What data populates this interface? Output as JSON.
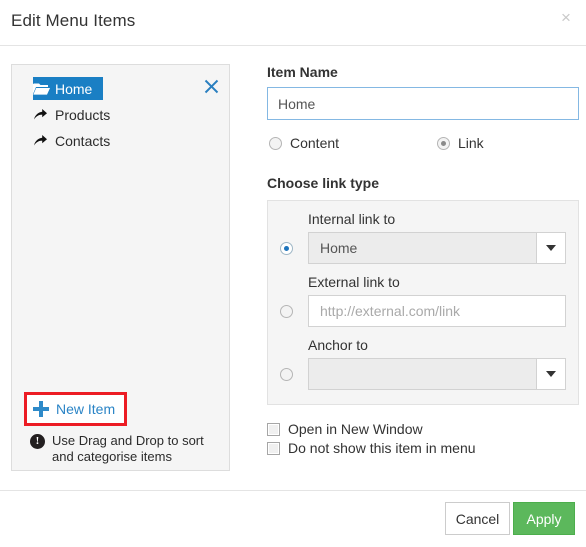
{
  "header": {
    "title": "Edit Menu Items",
    "close_label": "×",
    "close_icon": "close-icon"
  },
  "tree": {
    "items": [
      {
        "label": "Home",
        "icon": "folder-open-icon",
        "selected": true
      },
      {
        "label": "Products",
        "icon": "arrow-link-icon",
        "selected": false
      },
      {
        "label": "Contacts",
        "icon": "arrow-link-icon",
        "selected": false
      }
    ],
    "delete_icon": "delete-x-icon",
    "new_item": {
      "label": "New Item",
      "icon": "plus-icon",
      "highlight_color": "#ec1c24"
    },
    "hint": {
      "icon": "info-icon",
      "glyph": "!",
      "text": "Use Drag and Drop to sort and categorise items"
    }
  },
  "form": {
    "item_name_label": "Item Name",
    "item_name_value": "Home",
    "item_name_placeholder": "",
    "type_options": [
      {
        "label": "Content",
        "selected": false
      },
      {
        "label": "Link",
        "selected": true
      }
    ],
    "link_type_title": "Choose link type",
    "link_types": [
      {
        "label": "Internal link to",
        "control": "select",
        "value": "Home",
        "placeholder": "",
        "selected": true
      },
      {
        "label": "External link to",
        "control": "input",
        "value": "",
        "placeholder": "http://external.com/link",
        "selected": false
      },
      {
        "label": "Anchor to",
        "control": "select",
        "value": "",
        "placeholder": "",
        "selected": false
      }
    ],
    "checkboxes": [
      {
        "label": "Open in New Window",
        "checked": false
      },
      {
        "label": "Do not show this item in menu",
        "checked": false
      }
    ]
  },
  "footer": {
    "cancel_label": "Cancel",
    "apply_label": "Apply",
    "apply_color": "#5cb85c"
  }
}
